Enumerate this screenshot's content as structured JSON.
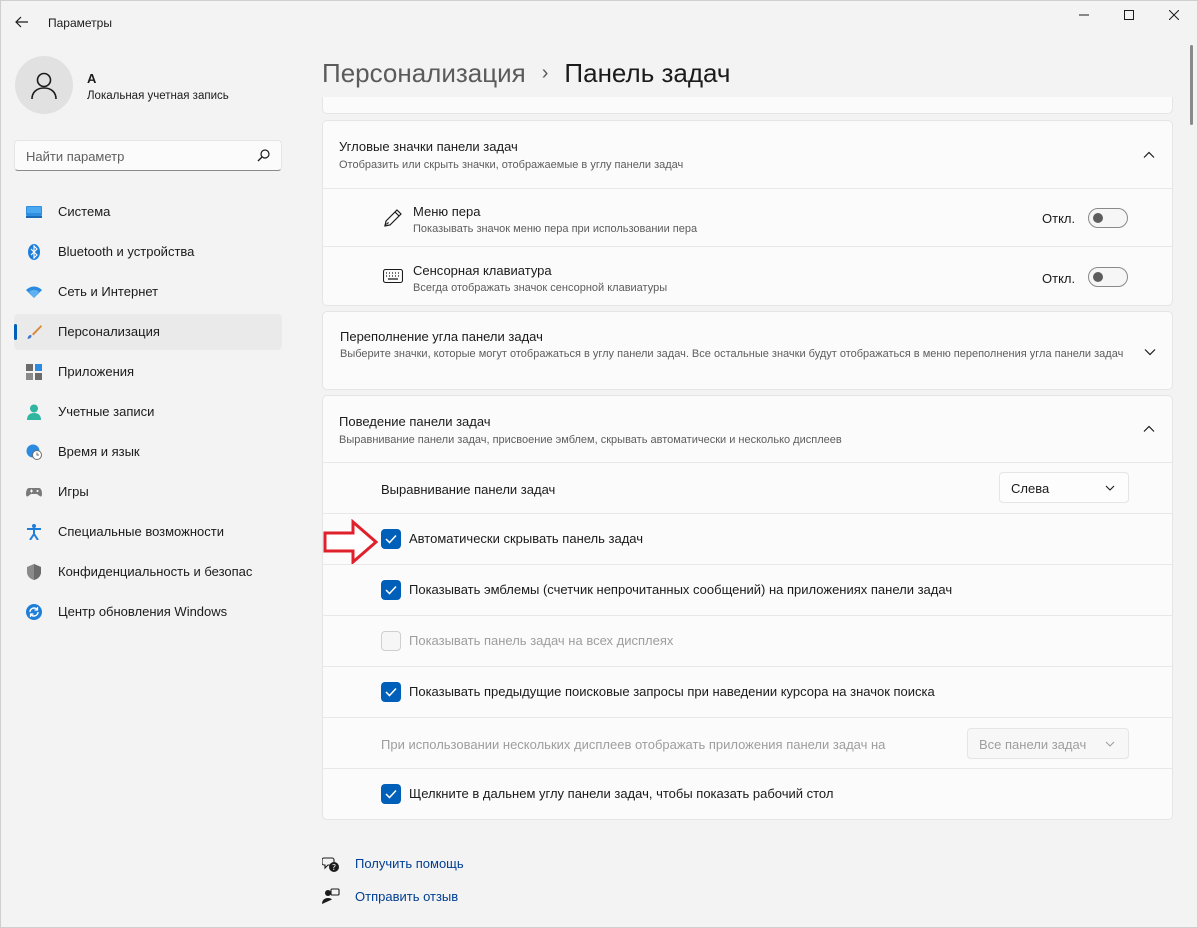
{
  "window": {
    "title": "Параметры"
  },
  "user": {
    "name": "A",
    "account_type": "Локальная учетная запись"
  },
  "search": {
    "placeholder": "Найти параметр"
  },
  "sidebar": {
    "items": [
      {
        "label": "Система",
        "icon": "system-icon"
      },
      {
        "label": "Bluetooth и устройства",
        "icon": "bluetooth-icon"
      },
      {
        "label": "Сеть и Интернет",
        "icon": "wifi-icon"
      },
      {
        "label": "Персонализация",
        "icon": "brush-icon",
        "active": true
      },
      {
        "label": "Приложения",
        "icon": "apps-icon"
      },
      {
        "label": "Учетные записи",
        "icon": "person-icon"
      },
      {
        "label": "Время и язык",
        "icon": "globe-clock-icon"
      },
      {
        "label": "Игры",
        "icon": "gamepad-icon"
      },
      {
        "label": "Специальные возможности",
        "icon": "accessibility-icon"
      },
      {
        "label": "Конфиденциальность и безопас",
        "icon": "shield-icon"
      },
      {
        "label": "Центр обновления Windows",
        "icon": "update-icon"
      }
    ]
  },
  "breadcrumb": {
    "parent": "Персонализация",
    "separator": "›",
    "current": "Панель задач"
  },
  "corner_icons": {
    "title": "Угловые значки панели задач",
    "subtitle": "Отобразить или скрыть значки, отображаемые в углу панели задач",
    "items": [
      {
        "title": "Меню пера",
        "subtitle": "Показывать значок меню пера при использовании пера",
        "state": "Откл.",
        "icon": "pen-icon"
      },
      {
        "title": "Сенсорная клавиатура",
        "subtitle": "Всегда отображать значок сенсорной клавиатуры",
        "state": "Откл.",
        "icon": "keyboard-icon"
      }
    ]
  },
  "overflow": {
    "title": "Переполнение угла панели задач",
    "subtitle": "Выберите значки, которые могут отображаться в углу панели задач. Все остальные значки будут отображаться в меню переполнения угла панели задач"
  },
  "behavior": {
    "title": "Поведение панели задач",
    "subtitle": "Выравнивание панели задач, присвоение эмблем, скрывать автоматически и несколько дисплеев",
    "alignment_label": "Выравнивание панели задач",
    "alignment_value": "Слева",
    "options": [
      {
        "label": "Автоматически скрывать панель задач",
        "checked": true
      },
      {
        "label": "Показывать эмблемы (счетчик непрочитанных сообщений) на приложениях панели задач",
        "checked": true
      },
      {
        "label": "Показывать панель задач на всех дисплеях",
        "checked": false,
        "disabled": true
      },
      {
        "label": "Показывать предыдущие поисковые запросы при наведении курсора на значок поиска",
        "checked": true
      }
    ],
    "multi_display_label": "При использовании нескольких дисплеев отображать приложения панели задач на",
    "multi_display_value": "Все панели задач",
    "corner_click_label": "Щелкните в дальнем углу панели задач, чтобы показать рабочий стол"
  },
  "footer": {
    "help": "Получить помощь",
    "feedback": "Отправить отзыв"
  },
  "colors": {
    "accent": "#005fb8",
    "annotation_arrow": "#e0202a"
  }
}
